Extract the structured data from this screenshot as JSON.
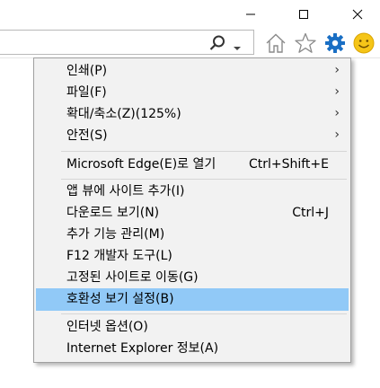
{
  "window": {
    "minimize_icon": "minimize-icon",
    "maximize_icon": "maximize-icon",
    "close_icon": "close-icon"
  },
  "toolbar": {
    "search_icon": "search-icon",
    "dropdown_icon": "chevron-down-icon",
    "home_icon": "home-icon",
    "favorites_icon": "star-icon",
    "tools_icon": "gear-icon",
    "feedback_icon": "smiley-icon",
    "tools_color": "#1a6fc4",
    "smile_color": "#f5c518"
  },
  "menu": {
    "highlight_color": "#91c9f7",
    "items": [
      {
        "label": "인쇄(P)",
        "shortcut": "",
        "submenu": true
      },
      {
        "label": "파일(F)",
        "shortcut": "",
        "submenu": true
      },
      {
        "label": "확대/축소(Z)(125%)",
        "shortcut": "",
        "submenu": true
      },
      {
        "label": "안전(S)",
        "shortcut": "",
        "submenu": true
      },
      {
        "label": "Microsoft Edge(E)로 열기",
        "shortcut": "Ctrl+Shift+E",
        "submenu": false
      },
      {
        "label": "앱 뷰에 사이트 추가(I)",
        "shortcut": "",
        "submenu": false
      },
      {
        "label": "다운로드 보기(N)",
        "shortcut": "Ctrl+J",
        "submenu": false
      },
      {
        "label": "추가 기능 관리(M)",
        "shortcut": "",
        "submenu": false
      },
      {
        "label": "F12 개발자 도구(L)",
        "shortcut": "",
        "submenu": false
      },
      {
        "label": "고정된 사이트로 이동(G)",
        "shortcut": "",
        "submenu": false
      },
      {
        "label": "호환성 보기 설정(B)",
        "shortcut": "",
        "submenu": false,
        "highlighted": true
      },
      {
        "label": "인터넷 옵션(O)",
        "shortcut": "",
        "submenu": false
      },
      {
        "label": "Internet Explorer 정보(A)",
        "shortcut": "",
        "submenu": false
      }
    ],
    "arrow_glyph": "›"
  }
}
